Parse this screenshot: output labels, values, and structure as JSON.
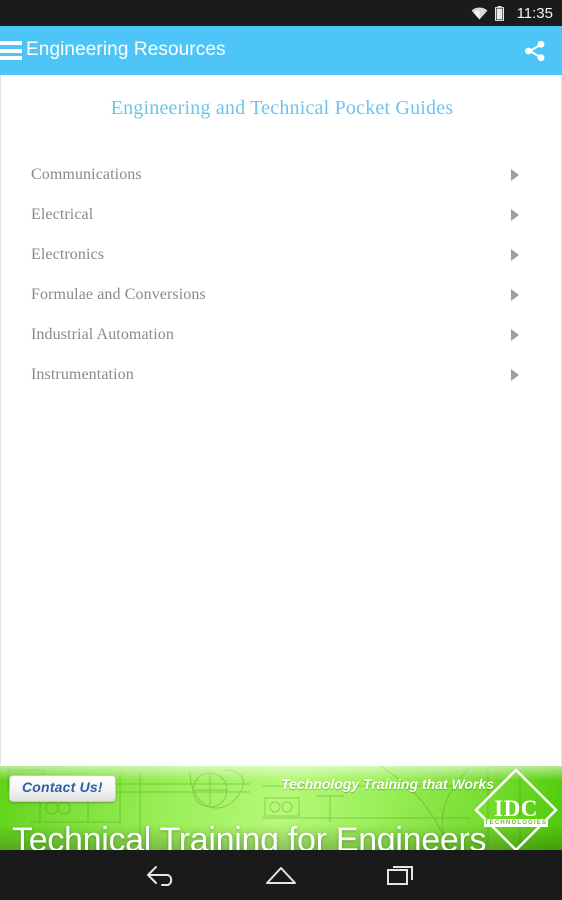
{
  "status_bar": {
    "time": "11:35",
    "wifi_icon": "wifi-icon",
    "battery_icon": "battery-icon"
  },
  "app_bar": {
    "menu_icon": "hamburger-menu-icon",
    "title": "Engineering Resources",
    "share_icon": "share-icon",
    "background_color": "#4ec5f7"
  },
  "main": {
    "page_title": "Engineering and Technical Pocket Guides",
    "page_title_color": "#6fc4ea",
    "guides": [
      {
        "label": "Communications",
        "arrow_icon": "chevron-right-icon"
      },
      {
        "label": "Electrical",
        "arrow_icon": "chevron-right-icon"
      },
      {
        "label": "Electronics",
        "arrow_icon": "chevron-right-icon"
      },
      {
        "label": "Formulae and Conversions",
        "arrow_icon": "chevron-right-icon"
      },
      {
        "label": "Industrial Automation",
        "arrow_icon": "chevron-right-icon"
      },
      {
        "label": "Instrumentation",
        "arrow_icon": "chevron-right-icon"
      }
    ]
  },
  "ad": {
    "contact_label": "Contact Us!",
    "tagline": "Technology Training that Works",
    "headline": "Technical Training for Engineers",
    "logo_name": "IDC",
    "logo_subtitle": "TECHNOLOGIES",
    "accent_color": "#7ee03a"
  },
  "nav_bar": {
    "back_icon": "back-arrow-icon",
    "home_icon": "home-icon",
    "recents_icon": "recent-apps-icon"
  }
}
